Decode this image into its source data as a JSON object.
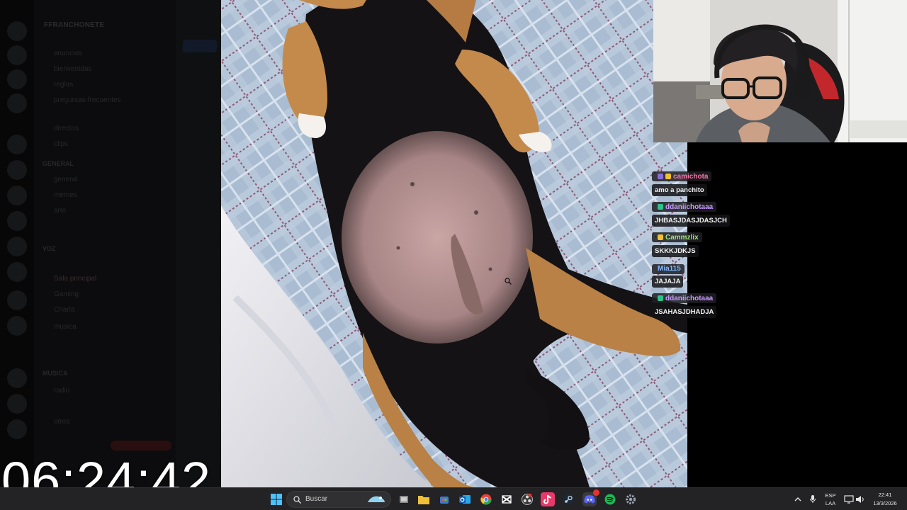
{
  "timer": "06:24:42",
  "discord": {
    "server_name": "FFRANCHONETE",
    "channels": [
      "anuncios",
      "bienvenidas",
      "reglas",
      "preguntas-frecuentes",
      "directos",
      "clips",
      "GENERAL",
      "general",
      "memes",
      "arte",
      "VOZ",
      "Sala principal",
      "Gaming",
      "Charla",
      "musica",
      "MUSICA",
      "radio",
      "otros"
    ],
    "status_pill": ""
  },
  "chat": [
    {
      "user": "camichota",
      "color": "#ff6fa8",
      "badge_colors": [
        "#8a6bd9",
        "#f2c12e"
      ],
      "text": "amo a panchito"
    },
    {
      "user": "ddaniichotaaa",
      "color": "#c79bff",
      "badge_colors": [
        "#2ec38a"
      ],
      "text": "JHBASJDASJDASJCH"
    },
    {
      "user": "Cammzlix",
      "color": "#9be57a",
      "badge_colors": [
        "#f2c12e"
      ],
      "text": "SKKKJDKJS"
    },
    {
      "user": "Mia115",
      "color": "#7fb6ff",
      "badge_colors": [],
      "text": "JAJAJA"
    },
    {
      "user": "ddaniichotaaa",
      "color": "#c79bff",
      "badge_colors": [
        "#2ec38a"
      ],
      "text": "JSAHASJDHADJA"
    }
  ],
  "taskbar": {
    "search_label": "Buscar",
    "lang_top": "ESP",
    "lang_bottom": "LAA",
    "time": "22:41",
    "date": "13/3/2026",
    "icons": [
      {
        "name": "file-explorer-icon",
        "color": "#f0c03c"
      },
      {
        "name": "store-icon",
        "color": "#3a7bd5"
      },
      {
        "name": "outlook-icon",
        "color": "#1f6fd1"
      },
      {
        "name": "chrome-icon",
        "color": "#e8463b"
      },
      {
        "name": "capcut-icon",
        "color": "#ffffff"
      },
      {
        "name": "obs-icon",
        "color": "#5a5a5a"
      },
      {
        "name": "tiktok-icon",
        "color": "#e8396b"
      },
      {
        "name": "steam-icon",
        "color": "#1b2838"
      },
      {
        "name": "discord-icon",
        "color": "#5865f2"
      },
      {
        "name": "spotify-icon",
        "color": "#1db954"
      },
      {
        "name": "settings-icon",
        "color": "#8a8a8a"
      }
    ]
  }
}
